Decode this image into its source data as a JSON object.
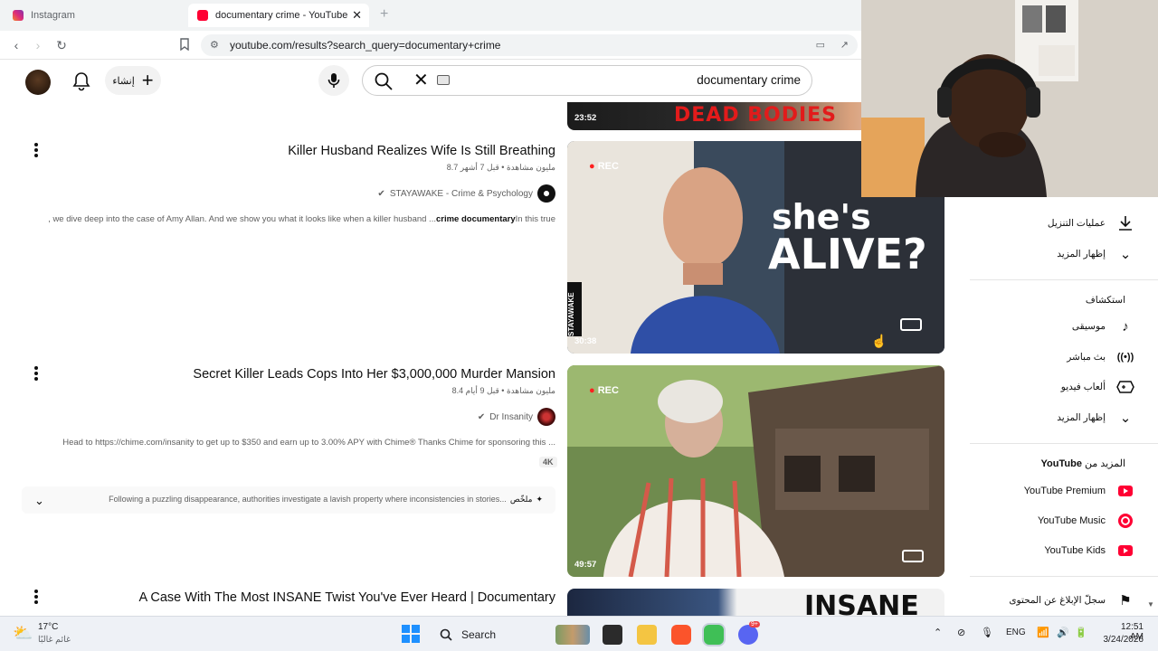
{
  "browser": {
    "tabs": [
      {
        "label": "Instagram",
        "active": false
      },
      {
        "label": "documentary crime - YouTube",
        "active": true
      }
    ],
    "url": "youtube.com/results?search_query=documentary+crime"
  },
  "header": {
    "create_label": "إنشاء",
    "search_value": "documentary crime"
  },
  "top_partial": {
    "duration": "23:52",
    "overlay_text": "DEAD BODIES"
  },
  "results": [
    {
      "title": "Killer Husband Realizes Wife Is Still Breathing",
      "meta": "8.7 مليون مشاهدة • قبل 7 أشهر",
      "channel": "STAYAWAKE - Crime & Psychology",
      "verified": true,
      "description_pre": ", we dive deep into the case of Amy Allan. And we show you what it looks like when a killer husband ...",
      "description_bold": "crime documentary",
      "description_post": "In this true",
      "duration": "30:38",
      "overlay_text_1": "she's",
      "overlay_text_2": "ALIVE?",
      "rec": "REC",
      "watermark": "STAYAWAKE"
    },
    {
      "title": "Secret Killer Leads Cops Into Her $3,000,000 Murder Mansion",
      "meta": "8.4 مليون مشاهدة • قبل 9 أيام",
      "channel": "Dr Insanity",
      "verified": true,
      "description": "Head to https://chime.com/insanity to get up to $350 and earn up to 3.00% APY with Chime® Thanks Chime for sponsoring this ...",
      "badge": "4K",
      "summary_label": "ملخّص",
      "summary": "Following a puzzling disappearance, authorities investigate a lavish property where inconsistencies in stories...",
      "duration": "49:57",
      "rec": "REC"
    },
    {
      "title": "A Case With The Most INSANE Twist You've Ever Heard | Documentary",
      "overlay_text": "INSANE"
    }
  ],
  "sidebar": {
    "items_top": [
      {
        "label": "عمليات التنزيل",
        "icon": "download-icon"
      },
      {
        "label": "إظهار المزيد",
        "icon": "chevron-down-icon"
      }
    ],
    "explore_heading": "استكشاف",
    "explore": [
      {
        "label": "موسيقى",
        "icon": "music-note-icon"
      },
      {
        "label": "بث مباشر",
        "icon": "live-icon"
      },
      {
        "label": "ألعاب فيديو",
        "icon": "gaming-icon"
      },
      {
        "label": "إظهار المزيد",
        "icon": "chevron-down-icon"
      }
    ],
    "more_heading_prefix": "المزيد من",
    "more_heading_brand": "YouTube",
    "more": [
      {
        "label": "YouTube Premium",
        "icon": "youtube-premium-icon"
      },
      {
        "label": "YouTube Music",
        "icon": "youtube-music-icon"
      },
      {
        "label": "YouTube Kids",
        "icon": "youtube-kids-icon"
      }
    ],
    "report_label": "سجلّ الإبلاغ عن المحتوى"
  },
  "taskbar": {
    "weather_temp": "17°C",
    "weather_desc": "غائم غالبًا",
    "search_label": "Search",
    "lang": "ENG",
    "time": "12:51 AM",
    "date": "3/24/2026",
    "notif_count": "9+"
  },
  "colors": {
    "youtube_red": "#ff0033",
    "text_primary": "#0f0f0f",
    "text_secondary": "#606060"
  }
}
